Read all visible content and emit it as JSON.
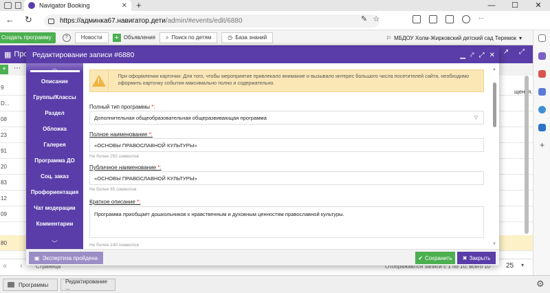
{
  "browser": {
    "tab_title": "Navigator Booking",
    "tab_close": "✕",
    "new_tab": "+",
    "url_host": "https://админка67.навигатор.дети",
    "url_path": "/admin/#events/edit/6880"
  },
  "toolbar": {
    "create_label": "Создать программу",
    "tabs": [
      "Новости",
      "Объявления",
      "Поиск по детям",
      "База знаний"
    ],
    "org_name": "МБДОУ Холм-Жирковский детский сад Теремок"
  },
  "background": {
    "title": "Програ",
    "column_head": "щения...",
    "row_ids": [
      "9",
      "D...",
      "08",
      "23",
      "91",
      "20",
      "83",
      "12",
      "09",
      "80"
    ],
    "row_prefix": "ö",
    "footer_left": "Страница",
    "footer_right": "Отображаются записи с 1 по 10, всего 10",
    "page_size": "25"
  },
  "modal": {
    "title": "Редактирование записи #6880",
    "nav_items": [
      "Описание",
      "Группы/Классы",
      "Раздел",
      "Обложка",
      "Галерея",
      "Программа ДО",
      "Соц. заказ",
      "Профориентация",
      "Чат модерации",
      "Комментарии"
    ],
    "warning_text": "При оформлении карточки: Для того, чтобы мероприятие привлекало внимание и вызывало интерес большого числа посетителей сайта, необходимо оформить карточку события максимально полно и содержательно.",
    "fields": {
      "program_type_label": "Полный тип программы",
      "program_type_value": "Дополнительная общеобразовательная общеразвивающая программа",
      "full_name_label": "Полное наименование",
      "full_name_value": "«ОСНОВЫ ПРАВОСЛАВНОЙ КУЛЬТУРЫ»",
      "full_name_hint": "Не более 250 символов",
      "public_name_label": "Публичное наименование",
      "public_name_value": "«ОСНОВЫ ПРАВОСЛАВНОЙ КУЛЬТУРЫ»",
      "public_name_hint": "Не более 65 символов",
      "short_desc_label": "Краткое описание",
      "short_desc_value": "Программа  приобщает дошкольников  к нравственным и духовным ценностям православной культуры.",
      "short_desc_hint": "Не более 140 символов",
      "required_mark": "*:"
    },
    "footer": {
      "expert_label": "Экспертиза пройдена",
      "save_label": "Сохранить",
      "close_label": "Закрыть"
    }
  },
  "taskbar": {
    "items": [
      "Программы",
      "Редактирование ..."
    ]
  },
  "colors": {
    "brand_purple": "#5a3da8",
    "success_green": "#4caf50",
    "warning_bg": "#fbe7b6",
    "required_red": "#e53935"
  }
}
